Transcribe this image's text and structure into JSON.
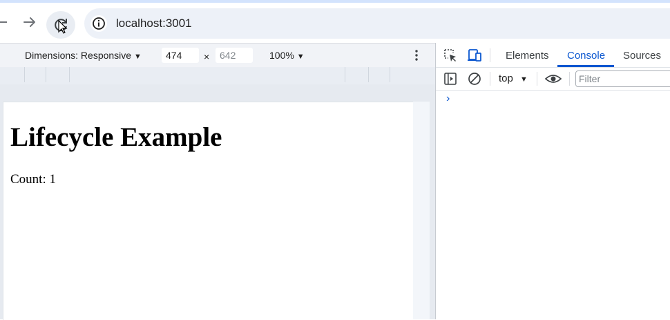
{
  "browser": {
    "url": "localhost:3001"
  },
  "device_toolbar": {
    "dimensions_label": "Dimensions: Responsive",
    "width_value": "474",
    "times": "×",
    "height_value": "642",
    "zoom": "100%"
  },
  "page": {
    "heading": "Lifecycle Example",
    "count_text": "Count: 1"
  },
  "devtools": {
    "tabs": [
      "Elements",
      "Console",
      "Sources"
    ],
    "active_tab": "Console",
    "context": "top",
    "filter_placeholder": "Filter",
    "prompt": "›"
  },
  "colors": {
    "accent": "#0b57d0",
    "top_strip": "#d3e3fd",
    "omnibox_bg": "#edf1f8"
  }
}
